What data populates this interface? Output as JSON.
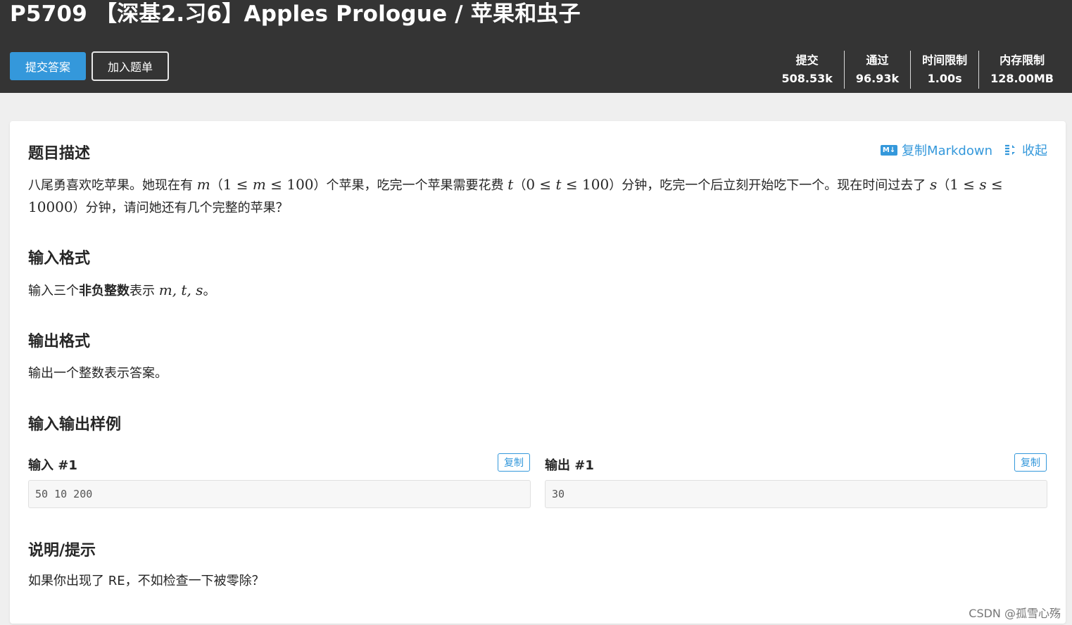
{
  "header": {
    "title": "P5709 【深基2.习6】Apples Prologue / 苹果和虫子",
    "submit_label": "提交答案",
    "add_list_label": "加入题单",
    "stats": [
      {
        "label": "提交",
        "value": "508.53k"
      },
      {
        "label": "通过",
        "value": "96.93k"
      },
      {
        "label": "时间限制",
        "value": "1.00s"
      },
      {
        "label": "内存限制",
        "value": "128.00MB"
      }
    ]
  },
  "actions": {
    "md_badge": "M↓",
    "copy_markdown": "复制Markdown",
    "collapse": "收起"
  },
  "description": {
    "title": "题目描述",
    "t1": "八尾勇喜欢吃苹果。她现在有 ",
    "m": "m",
    "t2": "（",
    "c1_left": "1 ≤ ",
    "c1_var": "m",
    "c1_right": " ≤ 100",
    "t3": "）个苹果，吃完一个苹果需要花费 ",
    "t": "t",
    "t4": "（",
    "c2_left": "0 ≤ ",
    "c2_var": "t",
    "c2_right": " ≤ 100",
    "t5": "）分钟，吃完一个后立刻开始吃下一个。现在时间过去了 ",
    "s": "s",
    "t6": "（",
    "c3_left": "1 ≤ ",
    "c3_var": "s",
    "c3_right": " ≤ 10000",
    "t7": "）分钟，请问她还有几个完整的苹果？"
  },
  "input_format": {
    "title": "输入格式",
    "pre": "输入三个",
    "bold": "非负整数",
    "mid": "表示 ",
    "vars": "m, t, s",
    "end": "。"
  },
  "output_format": {
    "title": "输出格式",
    "text": "输出一个整数表示答案。"
  },
  "samples": {
    "title": "输入输出样例",
    "input_label": "输入 #1",
    "output_label": "输出 #1",
    "copy_label": "复制",
    "input_value": "50 10 200",
    "output_value": "30"
  },
  "hint": {
    "title": "说明/提示",
    "text": "如果你出现了 RE，不如检查一下被零除？"
  },
  "watermark": "CSDN @孤雪心殇"
}
